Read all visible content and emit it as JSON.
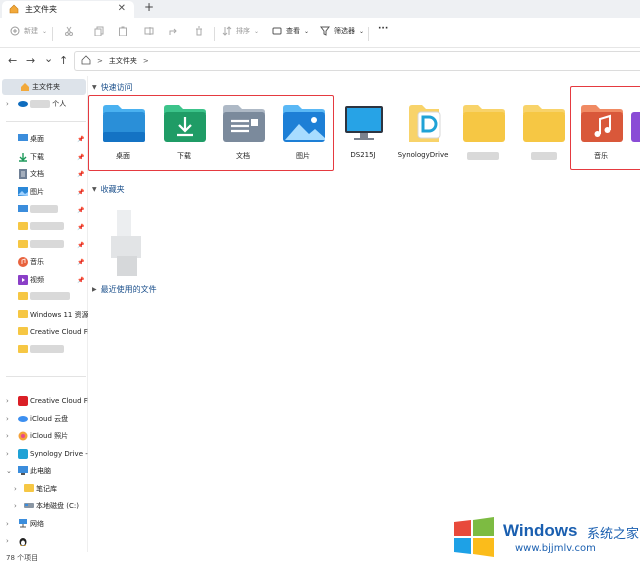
{
  "window": {
    "tab_title": "主文件夹",
    "new_tab": "+",
    "tab_close": "✕"
  },
  "toolbar": {
    "new_label": "新建",
    "sort_label": "排序",
    "view_label": "查看",
    "filter_label": "筛选器",
    "more_label": "···"
  },
  "nav": {
    "back": "←",
    "forward": "→",
    "down": "⌄",
    "up": "↑"
  },
  "address": {
    "crumb": "主文件夹",
    "chev1": ">",
    "chev2": ">"
  },
  "sidebar": {
    "items": [
      {
        "label": "主文件夹"
      },
      {
        "label": "个人"
      },
      {
        "label": "桌面"
      },
      {
        "label": "下载"
      },
      {
        "label": "文档"
      },
      {
        "label": "图片"
      },
      {
        "label": "音乐"
      },
      {
        "label": "视频"
      },
      {
        "label": "Windows 11 资源"
      },
      {
        "label": "Creative Cloud Fil"
      },
      {
        "label": "Creative Cloud Fil"
      },
      {
        "label": "iCloud 云盘"
      },
      {
        "label": "iCloud 照片"
      },
      {
        "label": "Synology Drive -"
      },
      {
        "label": "此电脑"
      },
      {
        "label": "笔记库"
      },
      {
        "label": "本地磁盘 (C:)"
      },
      {
        "label": "网络"
      }
    ]
  },
  "main": {
    "quick_access_title": "快速访问",
    "favorites_title": "收藏夹",
    "recent_title": "最近使用的文件",
    "quick_access": [
      {
        "label": "桌面"
      },
      {
        "label": "下载"
      },
      {
        "label": "文档"
      },
      {
        "label": "图片"
      },
      {
        "label": "DS215J"
      },
      {
        "label": "SynologyDrive"
      },
      {
        "label": ""
      },
      {
        "label": ""
      },
      {
        "label": "音乐"
      },
      {
        "label": ""
      }
    ]
  },
  "status": {
    "item_count": "78 个项目"
  },
  "watermark": {
    "windows": "Windows",
    "site_name": "系统之家",
    "url": "www.bjjmlv.com"
  },
  "colors": {
    "highlight_box": "#e53a40",
    "accent": "#0f6cbd",
    "folder_yellow": "#f6c744"
  }
}
